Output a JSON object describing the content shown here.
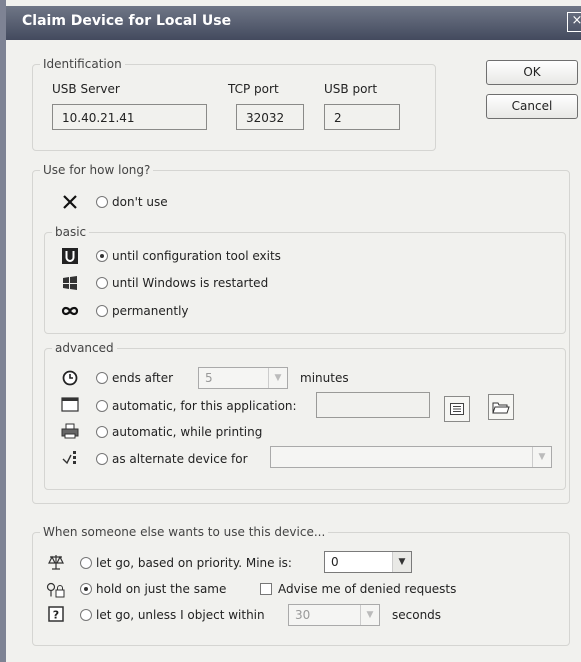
{
  "window": {
    "title": "Claim Device for Local Use",
    "close_symbol": "×"
  },
  "buttons": {
    "ok": "OK",
    "cancel": "Cancel"
  },
  "identification": {
    "legend": "Identification",
    "usb_server_label": "USB Server",
    "usb_server_value": "10.40.21.41",
    "tcp_port_label": "TCP port",
    "tcp_port_value": "32032",
    "usb_port_label": "USB port",
    "usb_port_value": "2"
  },
  "duration": {
    "legend": "Use for how long?",
    "dont_use": "don't use",
    "basic": {
      "legend": "basic",
      "until_tool_exits": "until configuration tool exits",
      "until_windows_restart": "until Windows is restarted",
      "permanently": "permanently"
    },
    "advanced": {
      "legend": "advanced",
      "ends_after": "ends after",
      "ends_after_value": "5",
      "minutes": "minutes",
      "automatic_app": "automatic, for this application:",
      "automatic_printing": "automatic, while printing",
      "alternate_device": "as alternate device for"
    }
  },
  "contention": {
    "legend": "When someone else wants to use this device...",
    "let_go_priority": "let go, based on priority. Mine is:",
    "priority_value": "0",
    "hold_on": "hold on just the same",
    "advise_denied": "Advise me of denied requests",
    "let_go_unless": "let go, unless I object within",
    "object_seconds_value": "30",
    "seconds": "seconds"
  },
  "selected": {
    "duration": "until_tool_exits",
    "contention": "hold_on"
  }
}
